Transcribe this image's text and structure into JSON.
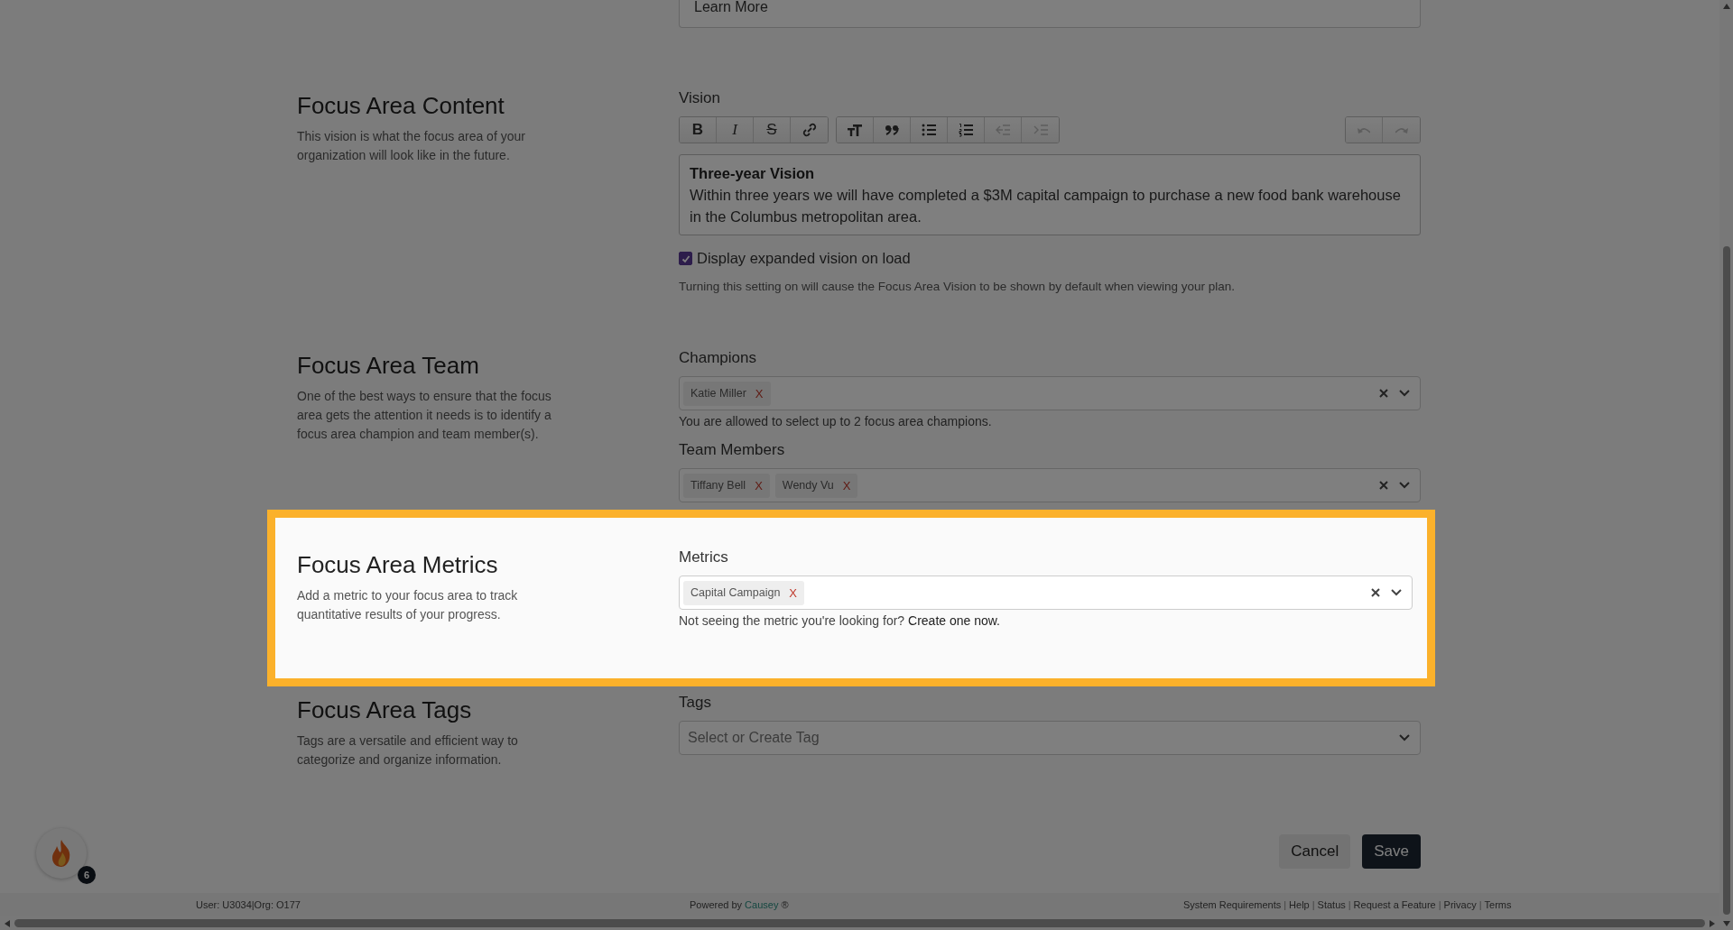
{
  "top_field": {
    "text": "Learn More"
  },
  "sections": [
    {
      "title": "Focus Area Content",
      "description": "This vision is what the focus area of your organization will look like in the future.",
      "highlighted": false,
      "fields": [
        {
          "kind": "editor",
          "label": "Vision",
          "toolbar_groups": [
            {
              "buttons": [
                {
                  "glyph": "B",
                  "disabled": false
                },
                {
                  "glyph": "I",
                  "disabled": false
                },
                {
                  "glyph": "S",
                  "disabled": false
                },
                {
                  "disabled": false
                }
              ]
            },
            {
              "buttons": [
                {
                  "disabled": false
                },
                {
                  "disabled": false
                },
                {
                  "disabled": false
                },
                {
                  "disabled": false
                },
                {
                  "disabled": true
                },
                {
                  "disabled": true
                }
              ]
            },
            {
              "buttons": [
                {
                  "disabled": true
                },
                {
                  "disabled": true
                }
              ]
            }
          ],
          "heading": "Three-year Vision",
          "body": "Within three years we will have completed a $3M capital campaign to purchase a new food bank warehouse in the Columbus metropolitan area."
        },
        {
          "kind": "checkbox",
          "label": "Display expanded vision on load",
          "checked": true,
          "help": "Turning this setting on will cause the Focus Area Vision to be shown by default when viewing your plan."
        }
      ]
    },
    {
      "title": "Focus Area Team",
      "description": "One of the best ways to ensure that the focus area gets the attention it needs is to identify a focus area champion and team member(s).",
      "highlighted": false,
      "fields": [
        {
          "kind": "select",
          "label": "Champions",
          "chips": [
            {
              "label": "Katie Miller",
              "remove": "X"
            }
          ],
          "help": "You are allowed to select up to 2 focus area champions."
        },
        {
          "kind": "select",
          "label": "Team Members",
          "chips": [
            {
              "label": "Tiffany Bell",
              "remove": "X"
            },
            {
              "label": "Wendy Vu",
              "remove": "X"
            }
          ]
        }
      ]
    },
    {
      "title": "Focus Area Metrics",
      "description": "Add a metric to your focus area to track quantitative results of your progress.",
      "highlighted": true,
      "fields": [
        {
          "kind": "select",
          "label": "Metrics",
          "chips": [
            {
              "label": "Capital Campaign",
              "remove": "X"
            }
          ],
          "help": "Not seeing the metric you're looking for? ",
          "help_link": "Create one now."
        }
      ]
    },
    {
      "title": "Focus Area Tags",
      "description": "Tags are a versatile and efficient way to categorize and organize information.",
      "highlighted": false,
      "fields": [
        {
          "kind": "select",
          "label": "Tags",
          "placeholder": "Select or Create Tag"
        }
      ]
    }
  ],
  "buttons": [
    {
      "label": "Cancel",
      "kind": "secondary"
    },
    {
      "label": "Save",
      "kind": "primary"
    }
  ],
  "widget": {
    "badge": "6"
  },
  "footer": {
    "user": "User: U3034|Org: O177",
    "powered_by": "Powered by",
    "brand": "Causey",
    "mark": "®",
    "links": [
      {
        "kind": "link",
        "text": "System Requirements"
      },
      {
        "kind": "separator",
        "text": "|"
      },
      {
        "kind": "link",
        "text": "Help"
      },
      {
        "kind": "separator",
        "text": "|"
      },
      {
        "kind": "link",
        "text": "Status"
      },
      {
        "kind": "separator",
        "text": "|"
      },
      {
        "kind": "link",
        "text": "Request a Feature"
      },
      {
        "kind": "separator",
        "text": "|"
      },
      {
        "kind": "link",
        "text": "Privacy"
      },
      {
        "kind": "separator",
        "text": "|"
      },
      {
        "kind": "link",
        "text": "Terms"
      }
    ]
  },
  "dimmed": true
}
